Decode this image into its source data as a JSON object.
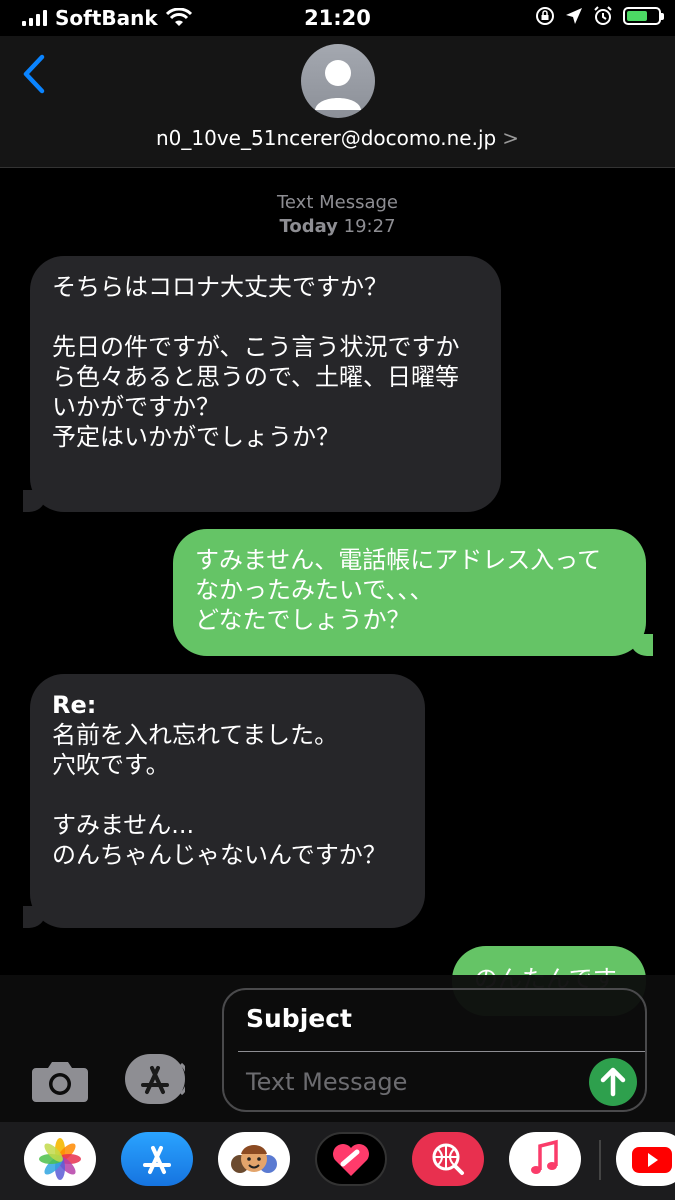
{
  "status_bar": {
    "carrier": "SoftBank",
    "time": "21:20"
  },
  "header": {
    "back_label": "<",
    "contact": "n0_10ve_51ncerer@docomo.ne.jp",
    "contact_chevron": ">"
  },
  "conversation_meta": {
    "service": "Text Message",
    "day": "Today",
    "time": "19:27"
  },
  "messages": [
    {
      "direction": "received",
      "lines": [
        "そちらはコロナ大丈夫ですか？",
        "",
        "先日の件ですが、こう言う状況ですか",
        "ら色々あると思うので、土曜、日曜等",
        "いかがですか？",
        "予定はいかがでしょうか？"
      ]
    },
    {
      "direction": "sent",
      "lines": [
        "すみません、電話帳にアドレス入って",
        "なかったみたいで、、、",
        "どなたでしょうか？"
      ]
    },
    {
      "direction": "received",
      "lines": [
        "Re:",
        "名前を入れ忘れてました。",
        "穴吹です。",
        "",
        "すみません...",
        "のんちゃんじゃないんですか？"
      ]
    },
    {
      "direction": "sent",
      "lines": [
        "のんたんです"
      ]
    }
  ],
  "compose": {
    "subject_placeholder": "Subject",
    "message_placeholder": "Text Message"
  },
  "app_drawer": [
    "photos-icon",
    "app-store-icon",
    "memoji-icon",
    "digital-touch-icon",
    "web-search-icon",
    "music-icon",
    "youtube-icon"
  ],
  "colors": {
    "sent_bubble": "#65c466",
    "received_bubble": "#262629",
    "link_blue": "#0a84ff",
    "send_button": "#2ea04d"
  }
}
